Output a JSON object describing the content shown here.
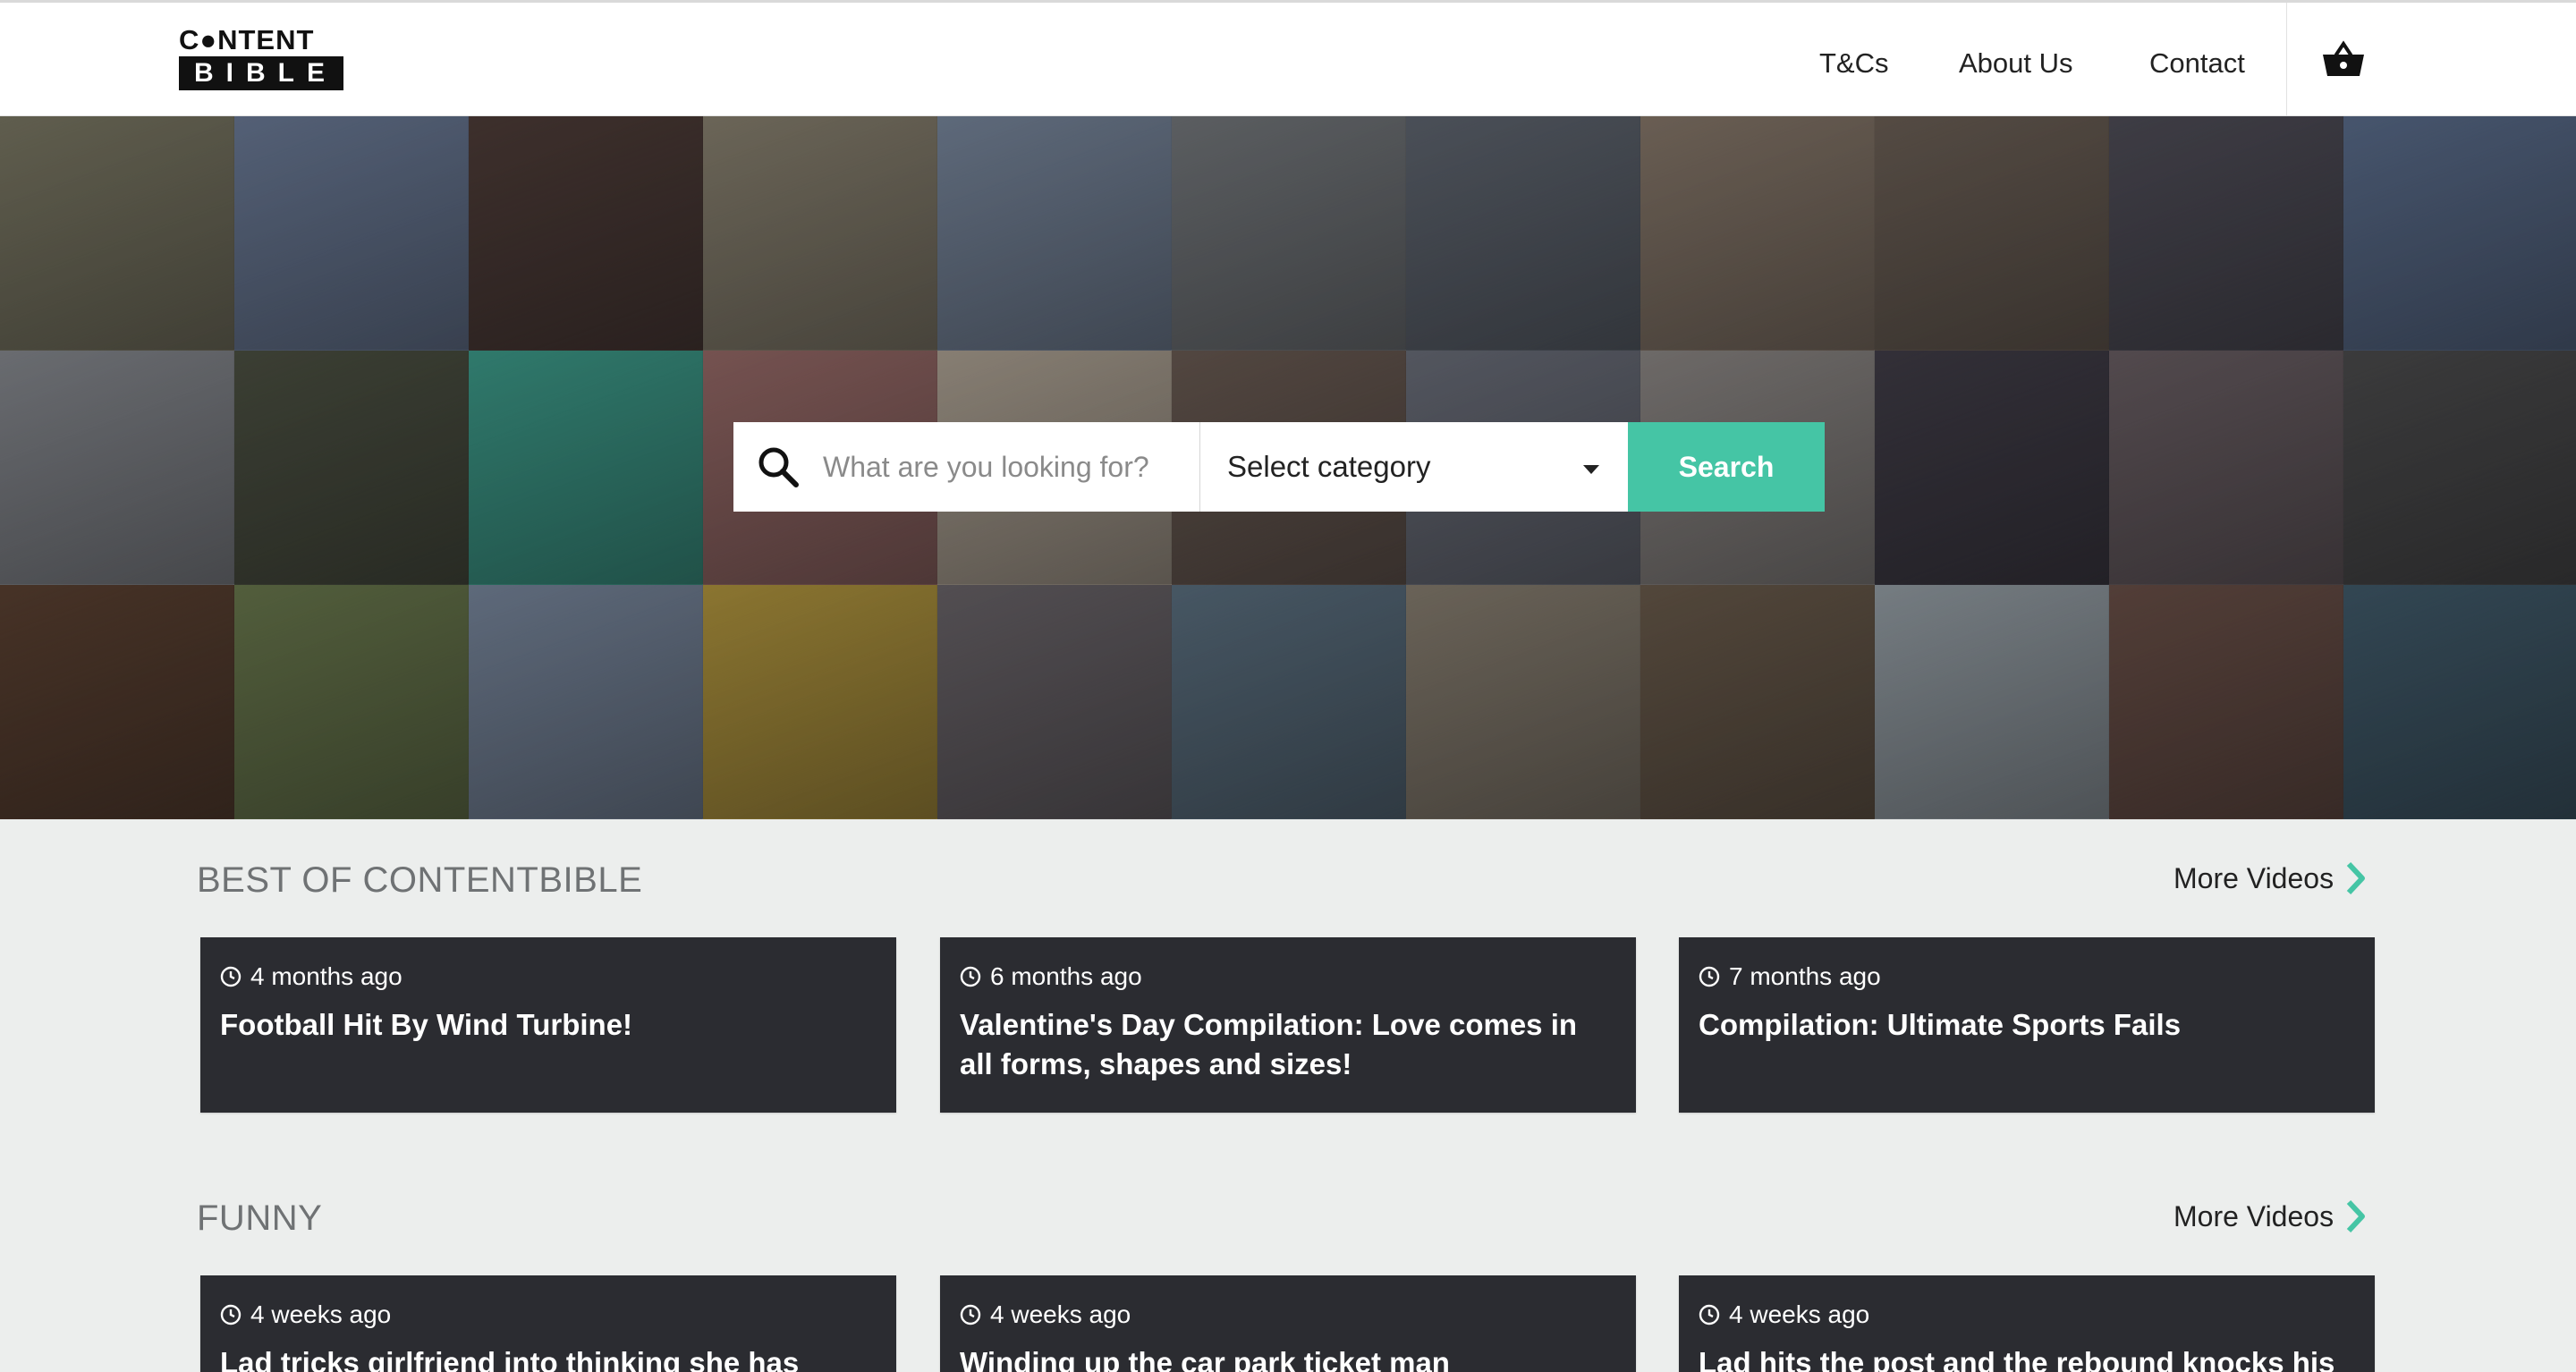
{
  "header": {
    "logo_top": "C●NTENT",
    "logo_bottom": "BIBLE",
    "nav": [
      {
        "label": "T&Cs"
      },
      {
        "label": "About Us"
      },
      {
        "label": "Contact"
      }
    ],
    "cart_icon": "basket-icon"
  },
  "hero": {
    "tile_colors": [
      "#7d7a63",
      "#6c7d9a",
      "#4d3a34",
      "#8c8470",
      "#7a8aa0",
      "#767a7d",
      "#5f6670",
      "#8a7a6a",
      "#6d6054",
      "#4e4c56",
      "#5a6e8e",
      "#8a8d92",
      "#4a4f3e",
      "#3aa08c",
      "#9a6a66",
      "#b3a796",
      "#6a5a50",
      "#6b6f7a",
      "#8f8a86",
      "#3e3a44",
      "#6a5e62",
      "#4a4a4a",
      "#5a3e2c",
      "#6a7a4a",
      "#7a8aa0",
      "#b89a3a",
      "#6a6468",
      "#5a7080",
      "#8a8070",
      "#6a5a48",
      "#9aa4aa",
      "#6a4e44",
      "#3e5a6a"
    ],
    "search": {
      "placeholder": "What are you looking for?",
      "category_label": "Select category",
      "button_label": "Search",
      "accent": "#45c5a5"
    }
  },
  "sections": [
    {
      "title": "BEST OF CONTENTBIBLE",
      "more_label": "More Videos",
      "cards": [
        {
          "meta": "4 months ago",
          "title": "Football Hit By Wind Turbine!"
        },
        {
          "meta": "6 months ago",
          "title": "Valentine's Day Compilation: Love comes in all forms, shapes and sizes!"
        },
        {
          "meta": "7 months ago",
          "title": "Compilation: Ultimate Sports Fails"
        }
      ]
    },
    {
      "title": "FUNNY",
      "more_label": "More Videos",
      "cards": [
        {
          "meta": "4 weeks ago",
          "title": "Lad tricks girlfriend into thinking she has huge"
        },
        {
          "meta": "4 weeks ago",
          "title": "Winding up the car park ticket man"
        },
        {
          "meta": "4 weeks ago",
          "title": "Lad hits the post and the rebound knocks his"
        }
      ]
    }
  ]
}
